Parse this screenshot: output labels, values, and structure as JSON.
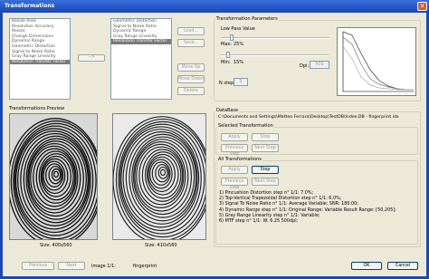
{
  "window": {
    "title": "Transformations",
    "close_label": "✕"
  },
  "available_list": [
    "Resize Area",
    "Resolution Accuracy",
    "Resize",
    "Change Dimensions",
    "Dynamic Range",
    "Geometric Distortion",
    "Signal to Noise Ratio",
    "Gray Range Linearity",
    "Resolution Transfer Factor"
  ],
  "selected_list": [
    "Geometric Distortion",
    "Signal to Noise Ratio",
    "Dynamic Range",
    "Gray Range Linearity",
    "Resolution Transfer Factor"
  ],
  "buttons": {
    "move_right": "-->",
    "load": "Load...",
    "save": "Save...",
    "move_up": "Move Up",
    "move_down": "Move Down",
    "delete": "Delete"
  },
  "params": {
    "group_label": "Transformation Parameters",
    "low_pass_label": "Low Pass Value",
    "max_label": "Max:",
    "max_value": "25%",
    "min_label": "Min:",
    "min_value": "15%",
    "dpi_label": "Dpi:",
    "dpi_value": "500",
    "nstep_label": "N step:",
    "nstep_value": "5"
  },
  "preview": {
    "label": "Transformations Preview",
    "left_size": "Size:  400x560",
    "right_size": "Size:  410x560"
  },
  "dataset": {
    "group_label": "DataBase",
    "path": "C:\\Documents and Settings\\Matteo Ferrara\\Desktop\\TestDB\\Index.DB - fingerprint.idx"
  },
  "selected_transformation": {
    "group_label": "Selected Transformation",
    "apply": "Apply",
    "stop": "Stop",
    "previous_step": "Previous Step",
    "next_step": "Next Step"
  },
  "all_transformations": {
    "group_label": "All Transformations",
    "apply": "Apply",
    "stop": "Stop",
    "previous_step": "Previous Step",
    "next_step": "Next Step"
  },
  "results": [
    "1) Pincushion Distortion step n° 1/1:  7.0%;",
    "2) Top-Vertical Trapezoidal Distortion step n° 1/1:  6.0%;",
    "3) Signal To Noise Ratio n° 1/1: Average Variable: SNR: 180.00;",
    "4) Dynamic Range step n° 1/1: Original Range: Variable  Result Range: [50,205];",
    "5) Gray Range Linearity step n° 1/1:  Variable;",
    "6) MTF step n° 1/1:  W: 6.25  500dpi;"
  ],
  "footer": {
    "previous": "Previous",
    "next": "Next",
    "image_label": "Image 1/1:",
    "image_name": "fingerprint",
    "ok": "OK",
    "cancel": "Cancel"
  },
  "chart_series_note": "",
  "colors": {
    "titlebar": "#2456c8",
    "selection": "#7a7a7a",
    "window_bg": "#ece9d8"
  }
}
